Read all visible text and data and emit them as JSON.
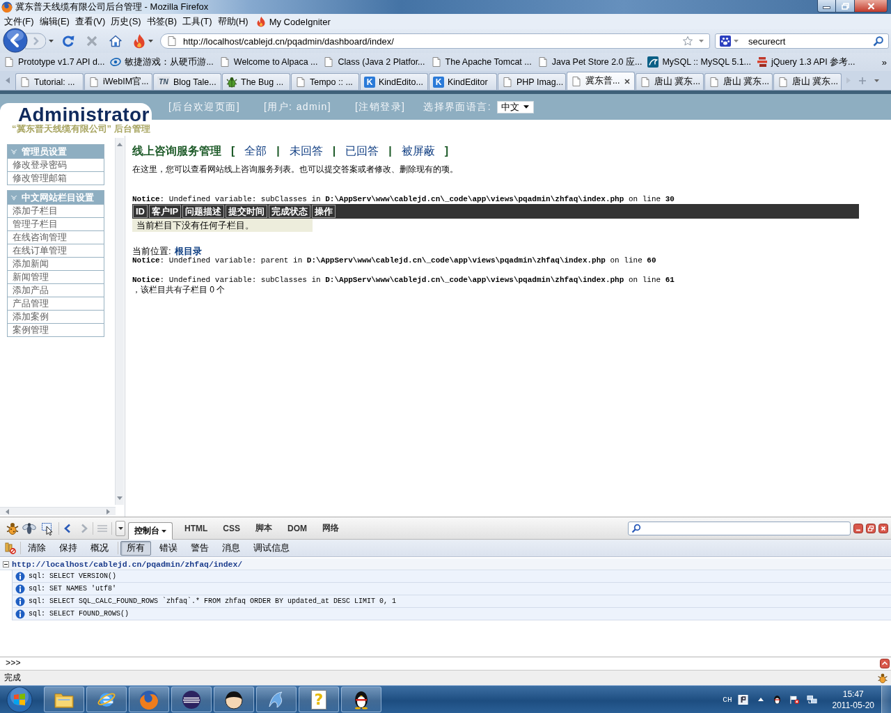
{
  "window": {
    "title": "冀东普天线缆有限公司后台管理 - Mozilla Firefox"
  },
  "menu_bar": {
    "items": [
      "文件(F)",
      "编辑(E)",
      "查看(V)",
      "历史(S)",
      "书签(B)",
      "工具(T)",
      "帮助(H)"
    ],
    "extension": "My CodeIgniter"
  },
  "navigation": {
    "url": "http://localhost/cablejd.cn/pqadmin/dashboard/index/",
    "search": {
      "value": "securecrt"
    }
  },
  "bookmarks": {
    "items": [
      {
        "label": "Prototype v1.7 API d...",
        "kind": "page"
      },
      {
        "label": "敏捷游戏：从硬币游...",
        "kind": "ring"
      },
      {
        "label": "Welcome to Alpaca ...",
        "kind": "page"
      },
      {
        "label": "Class (Java 2 Platfor...",
        "kind": "page"
      },
      {
        "label": "The Apache Tomcat ...",
        "kind": "page"
      },
      {
        "label": "Java Pet Store 2.0 应...",
        "kind": "page"
      },
      {
        "label": "MySQL :: MySQL 5.1...",
        "kind": "dolphin"
      },
      {
        "label": "jQuery 1.3 API 参考...",
        "kind": "stripes"
      }
    ],
    "more": "»"
  },
  "tabs": [
    {
      "label": "Tutorial: ...",
      "kind": "page",
      "selected": false
    },
    {
      "label": "iWebIM官...",
      "kind": "page",
      "selected": false
    },
    {
      "label": "Blog Tale...",
      "kind": "badge",
      "badge": "TN",
      "selected": false
    },
    {
      "label": "The Bug ...",
      "kind": "bug",
      "selected": false
    },
    {
      "label": "Tempo :: ...",
      "kind": "page",
      "selected": false
    },
    {
      "label": "KindEdito...",
      "kind": "badge",
      "badge": "K",
      "selected": false
    },
    {
      "label": "KindEditor",
      "kind": "badge",
      "badge": "K",
      "selected": false
    },
    {
      "label": "PHP Imag...",
      "kind": "page",
      "selected": false
    },
    {
      "label": "冀东普...",
      "kind": "page",
      "selected": true
    },
    {
      "label": "唐山 冀东...",
      "kind": "page",
      "selected": false
    },
    {
      "label": "唐山 冀东...",
      "kind": "page",
      "selected": false
    },
    {
      "label": "唐山 冀东...",
      "kind": "page",
      "selected": false
    }
  ],
  "page": {
    "header": {
      "logo": "Administrator",
      "links": [
        "[后台欢迎页面]",
        "[用户: admin]",
        "[注销登录]"
      ],
      "language_label": "选择界面语言:",
      "language": "中文",
      "subtitle": "“冀东普天线缆有限公司” 后台管理"
    },
    "sidebar": [
      {
        "title": "管理员设置",
        "items": [
          "修改登录密码",
          "修改管理邮箱"
        ]
      },
      {
        "title": "中文网站栏目设置",
        "items": [
          "添加子栏目",
          "管理子栏目",
          "在线咨询管理",
          "在线订单管理",
          "添加新闻",
          "新闻管理",
          "添加产品",
          "产品管理",
          "添加案例",
          "案例管理"
        ]
      }
    ],
    "content": {
      "title": "线上咨询服务管理",
      "filters": [
        {
          "text": "[",
          "kind": "bracket"
        },
        {
          "text": "全部",
          "kind": "link"
        },
        {
          "text": "|",
          "kind": "bracket"
        },
        {
          "text": "未回答",
          "kind": "link"
        },
        {
          "text": "|",
          "kind": "bracket"
        },
        {
          "text": "已回答",
          "kind": "link"
        },
        {
          "text": "|",
          "kind": "bracket"
        },
        {
          "text": "被屏蔽",
          "kind": "link"
        },
        {
          "text": "]",
          "kind": "bracket"
        }
      ],
      "description": "在这里，您可以查看网站线上咨询服务列表。也可以提交答案或者修改、删除现有的项。",
      "notice_before_table": "**Notice**: Undefined variable: subClasses in **D:\\AppServ\\www\\cablejd.cn\\_code\\app\\views\\pqadmin\\zhfaq\\index.php** on line **30**",
      "table": {
        "columns": [
          "ID",
          "客户IP",
          "问题描述",
          "提交时间",
          "完成状态",
          "操作"
        ],
        "empty_message": "当前栏目下没有任何子栏目。"
      },
      "breadcrumb": {
        "label": "当前位置:",
        "link": "根目录"
      },
      "notices_after_table": [
        "**Notice**: Undefined variable: parent in **D:\\AppServ\\www\\cablejd.cn\\_code\\app\\views\\pqadmin\\zhfaq\\index.php** on line **60**",
        "**Notice**: Undefined variable: subClasses in **D:\\AppServ\\www\\cablejd.cn\\_code\\app\\views\\pqadmin\\zhfaq\\index.php** on line **61**"
      ],
      "summary": "，该栏目共有子栏目 0 个"
    }
  },
  "firebug": {
    "tabs": [
      {
        "label": "控制台",
        "selected": true
      },
      {
        "label": "HTML",
        "selected": false
      },
      {
        "label": "CSS",
        "selected": false
      },
      {
        "label": "脚本",
        "selected": false
      },
      {
        "label": "DOM",
        "selected": false
      },
      {
        "label": "网络",
        "selected": false
      }
    ],
    "console_buttons": [
      "清除",
      "保持",
      "概况"
    ],
    "filters": [
      {
        "label": "所有",
        "selected": true
      },
      {
        "label": "错误",
        "selected": false
      },
      {
        "label": "警告",
        "selected": false
      },
      {
        "label": "消息",
        "selected": false
      },
      {
        "label": "调试信息",
        "selected": false
      }
    ],
    "log": {
      "url": "http://localhost/cablejd.cn/pqadmin/zhfaq/index/",
      "expanded": true,
      "entries": [
        "sql: SELECT VERSION()",
        "sql: SET NAMES 'utf8'",
        "sql: SELECT SQL_CALC_FOUND_ROWS `zhfaq`.* FROM zhfaq ORDER BY updated_at DESC LIMIT 0, 1",
        "sql: SELECT FOUND_ROWS()"
      ]
    },
    "command_prompt": ">>>"
  },
  "status_bar": {
    "text": "完成"
  },
  "taskbar": {
    "apps": [
      {
        "kind": "folder"
      },
      {
        "kind": "e-logo"
      },
      {
        "kind": "fox"
      },
      {
        "kind": "sphere"
      },
      {
        "kind": "head"
      },
      {
        "kind": "dolphin"
      },
      {
        "kind": "help",
        "badge": "?"
      },
      {
        "kind": "penguin"
      }
    ],
    "tray": {
      "language": "CH",
      "time": "15:47",
      "date": "2011-05-20"
    }
  }
}
